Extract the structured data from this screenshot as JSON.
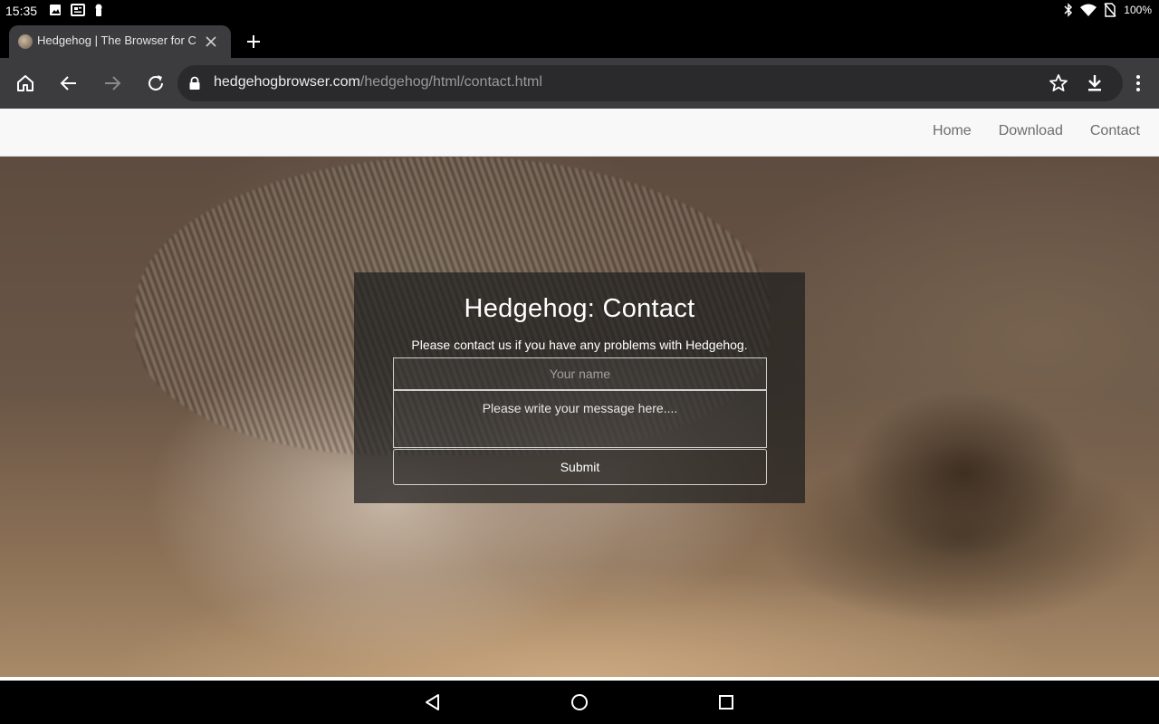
{
  "status_bar": {
    "time": "15:35",
    "battery": "100%",
    "icons": [
      "image-icon",
      "news-icon",
      "keyhole-icon",
      "bluetooth-icon",
      "wifi-icon",
      "no-sim-icon",
      "battery-icon"
    ]
  },
  "browser": {
    "tab": {
      "title": "Hedgehog | The Browser for Chrome"
    },
    "url": {
      "domain": "hedgehogbrowser.com",
      "path": "/hedgehog/html/contact.html"
    }
  },
  "site": {
    "nav": {
      "home": "Home",
      "download": "Download",
      "contact": "Contact"
    },
    "contact": {
      "title": "Hedgehog: Contact",
      "subtitle": "Please contact us if you have any problems with Hedgehog.",
      "name_placeholder": "Your name",
      "message_placeholder": "Please write your message here....",
      "submit_label": "Submit"
    }
  },
  "colors": {
    "browser_bar": "#3c3c3f",
    "omnibox": "#2a2a2c",
    "navbar_bg": "#f8f8f9",
    "nav_link": "#6d6d6d",
    "card_bg": "rgba(30,30,30,0.72)"
  }
}
